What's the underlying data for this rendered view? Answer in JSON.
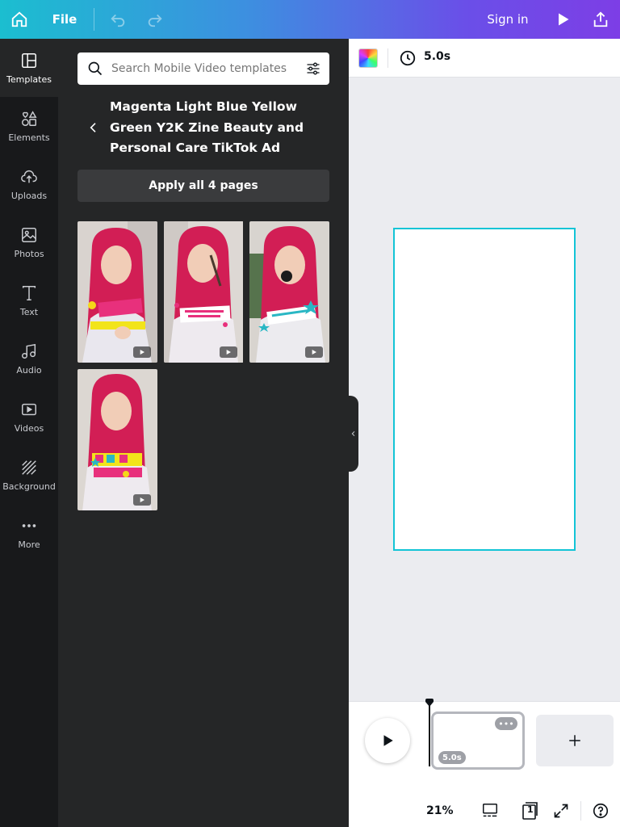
{
  "topbar": {
    "file_label": "File",
    "signin_label": "Sign in"
  },
  "rail": {
    "items": [
      {
        "label": "Templates",
        "icon": "templates-icon"
      },
      {
        "label": "Elements",
        "icon": "elements-icon"
      },
      {
        "label": "Uploads",
        "icon": "uploads-icon"
      },
      {
        "label": "Photos",
        "icon": "photos-icon"
      },
      {
        "label": "Text",
        "icon": "text-icon"
      },
      {
        "label": "Audio",
        "icon": "audio-icon"
      },
      {
        "label": "Videos",
        "icon": "videos-icon"
      },
      {
        "label": "Background",
        "icon": "background-icon"
      },
      {
        "label": "More",
        "icon": "more-icon"
      }
    ]
  },
  "panel": {
    "search_placeholder": "Search Mobile Video templates",
    "template_title": "Magenta Light Blue Yellow Green Y2K Zine Beauty and Personal Care TikTok Ad",
    "apply_label": "Apply all 4 pages",
    "pages": [
      {
        "name": "template-page-1"
      },
      {
        "name": "template-page-2"
      },
      {
        "name": "template-page-3"
      },
      {
        "name": "template-page-4"
      }
    ]
  },
  "editor": {
    "duration": "5.0s",
    "timeline_page_duration": "5.0s",
    "zoom": "21%",
    "page_count": "1"
  },
  "colors": {
    "accent_gradient_start": "#1bbed0",
    "accent_gradient_end": "#7d3ee6",
    "selection_border": "#13c4d6",
    "panel_bg": "#252627",
    "rail_bg": "#18191b"
  }
}
